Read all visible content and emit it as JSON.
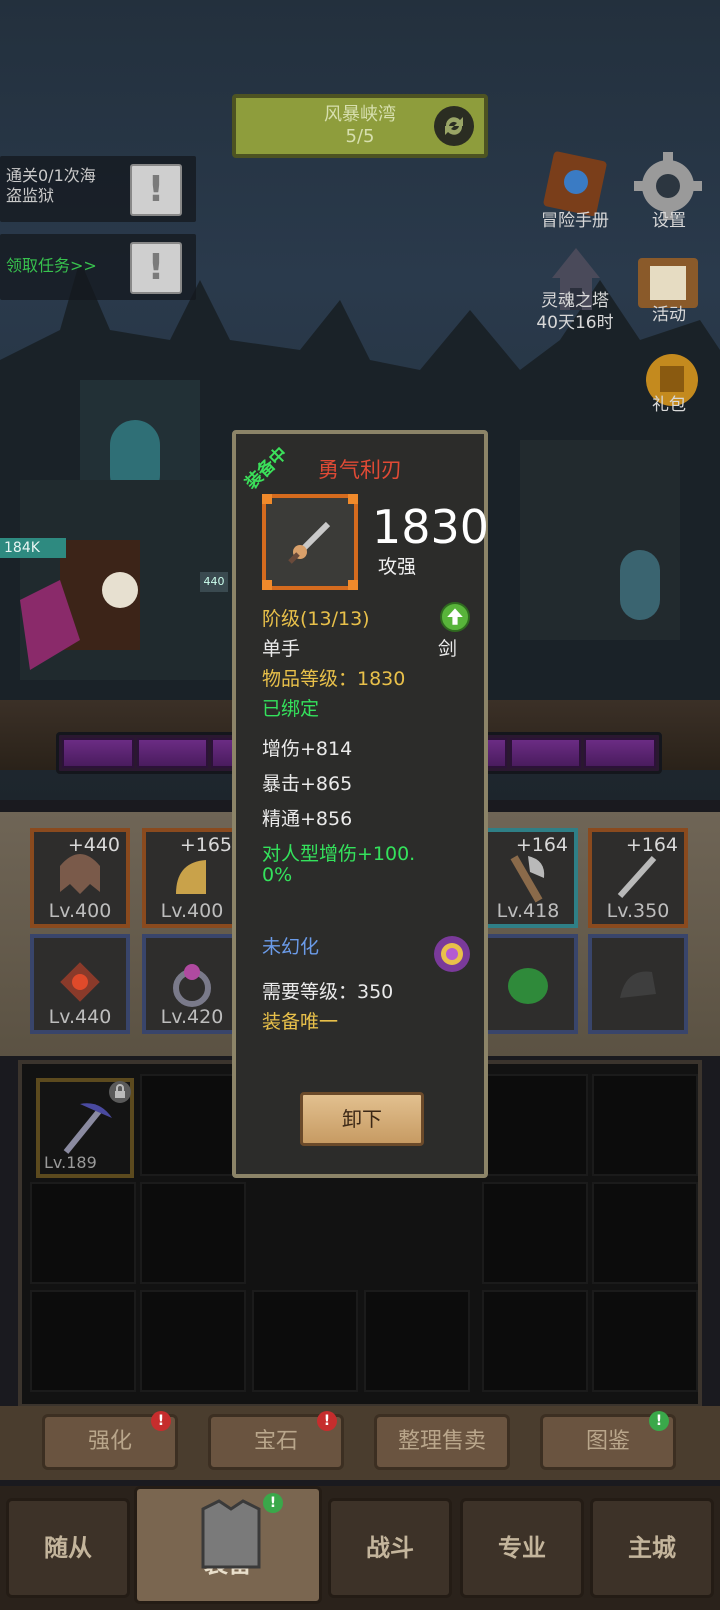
{
  "top_banner": {
    "title": "风暴峡湾",
    "progress": "5/5"
  },
  "quests": [
    {
      "text_line1": "通关0/1次海",
      "text_line2": "盗监狱",
      "icon": "!"
    },
    {
      "text_line1": "领取任务>>",
      "text_line2": "",
      "icon": "!"
    }
  ],
  "side_menu": {
    "adventure": "冒险手册",
    "settings": "设置",
    "soul_tower": "灵魂之塔",
    "soul_tower_timer": "40天16时",
    "activity": "活动",
    "gift": "礼包"
  },
  "hp_badge": "184K",
  "level_badge": "440",
  "equip_slots": [
    {
      "plus": "+440",
      "lv": "Lv.400",
      "border": "orange"
    },
    {
      "plus": "+165",
      "lv": "Lv.400",
      "border": "orange"
    },
    {
      "plus": "+164",
      "lv": "Lv.418",
      "border": "teal"
    },
    {
      "plus": "+164",
      "lv": "Lv.350",
      "border": "orange"
    },
    {
      "plus": "",
      "lv": "Lv.440",
      "border": "blue"
    },
    {
      "plus": "",
      "lv": "Lv.420",
      "border": "blue"
    },
    {
      "plus": "",
      "lv": "",
      "border": "blue"
    },
    {
      "plus": "",
      "lv": "",
      "border": "blue"
    }
  ],
  "bag_item": {
    "lv": "Lv.189"
  },
  "bottom_buttons": {
    "enhance": "强化",
    "gem": "宝石",
    "sort_sell": "整理售卖",
    "codex": "图鉴"
  },
  "tabs": {
    "followers": "随从",
    "equipment": "装备",
    "battle": "战斗",
    "profession": "专业",
    "main_city": "主城"
  },
  "popup": {
    "equipped": "装备中",
    "name": "勇气利刃",
    "power": "1830",
    "power_label": "攻强",
    "tier": "阶级(13/13)",
    "hand": "单手",
    "weapon_type": "剑",
    "item_level": "物品等级：1830",
    "bound": "已绑定",
    "stat1": "增伤+814",
    "stat2": "暴击+865",
    "stat3": "精通+856",
    "special1": "对人型增伤+100.",
    "special2": "0%",
    "illusion": "未幻化",
    "req_level": "需要等级：350",
    "unique": "装备唯一",
    "unequip": "卸下"
  },
  "colors": {
    "name_red": "#e04a35",
    "gold": "#e8c04a",
    "green": "#34e25c",
    "blue": "#6b9be8",
    "frame_orange": "#d56b1e"
  }
}
